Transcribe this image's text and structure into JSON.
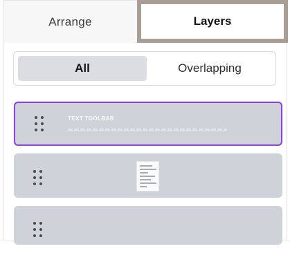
{
  "tabs": {
    "arrange_label": "Arrange",
    "layers_label": "Layers"
  },
  "filter": {
    "all_label": "All",
    "overlapping_label": "Overlapping",
    "selected": "All"
  },
  "layers": [
    {
      "title": "TEXT TOOLBAR",
      "selected": true
    },
    {
      "kind": "document-thumbnail",
      "selected": false
    },
    {
      "kind": "unknown",
      "selected": false
    }
  ],
  "colors": {
    "accent_selected": "#8b3df5",
    "active_tab_border": "#a89e95",
    "layer_bg": "#cfd2d8"
  }
}
